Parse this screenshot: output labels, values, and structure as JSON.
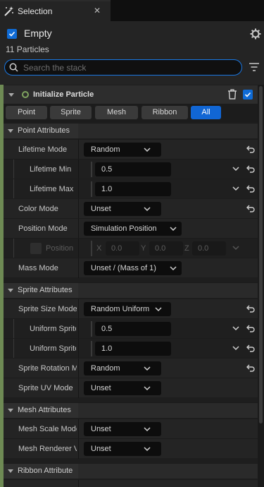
{
  "tab": {
    "title": "Selection",
    "icon": "magic-wand-icon",
    "close": "✕"
  },
  "header": {
    "emitter_name": "Empty",
    "particle_count": "11 Particles",
    "search_placeholder": "Search the stack"
  },
  "module": {
    "title": "Initialize Particle",
    "filters": [
      "Point",
      "Sprite",
      "Mesh",
      "Ribbon",
      "All"
    ],
    "active_filter": "All"
  },
  "sections": {
    "point": "Point Attributes",
    "sprite": "Sprite Attributes",
    "mesh": "Mesh Attributes",
    "ribbon": "Ribbon Attribute"
  },
  "params": {
    "lifetime_mode": {
      "label": "Lifetime Mode",
      "value": "Random"
    },
    "lifetime_min": {
      "label": "Lifetime Min",
      "value": "0.5"
    },
    "lifetime_max": {
      "label": "Lifetime Max",
      "value": "1.0"
    },
    "color_mode": {
      "label": "Color Mode",
      "value": "Unset"
    },
    "position_mode": {
      "label": "Position Mode",
      "value": "Simulation Position"
    },
    "position": {
      "label": "Position",
      "x_label": "X",
      "x": "0.0",
      "y_label": "Y",
      "y": "0.0",
      "z_label": "Z",
      "z": "0.0"
    },
    "mass_mode": {
      "label": "Mass Mode",
      "value": "Unset / (Mass of 1)"
    },
    "sprite_size_mode": {
      "label": "Sprite Size Mode",
      "value": "Random Uniform"
    },
    "uniform_sprite_size_min": {
      "label": "Uniform Sprite Size Min",
      "value": "0.5"
    },
    "uniform_sprite_size_max": {
      "label": "Uniform Sprite Size Max",
      "value": "1.0"
    },
    "sprite_rotation_mode": {
      "label": "Sprite Rotation Mode",
      "value": "Random"
    },
    "sprite_uv_mode": {
      "label": "Sprite UV Mode",
      "value": "Unset"
    },
    "mesh_scale_mode": {
      "label": "Mesh Scale Mode",
      "value": "Unset"
    },
    "mesh_renderer_mode": {
      "label": "Mesh Renderer Visibility",
      "value": "Unset"
    }
  },
  "colors": {
    "accent": "#1166d4",
    "module_green": "#6e8a54",
    "panel": "#242424"
  }
}
